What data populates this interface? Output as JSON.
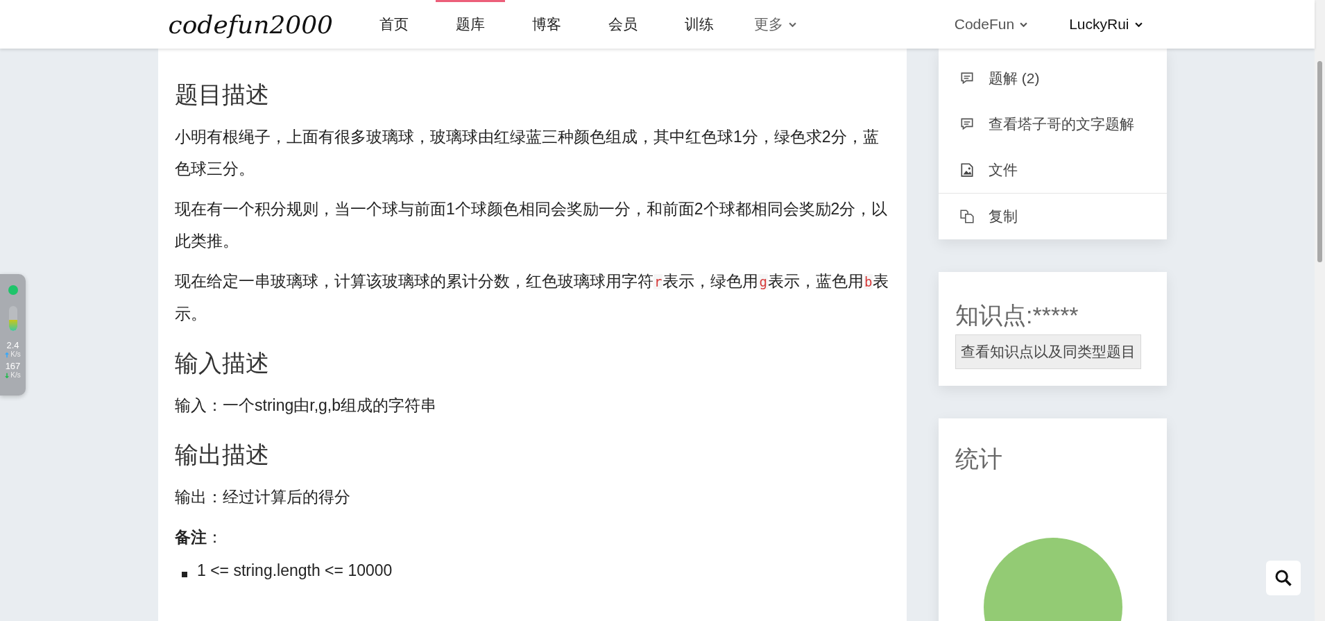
{
  "header": {
    "logo": "codefun2000",
    "nav": [
      {
        "label": "首页",
        "selected": false,
        "has_menu": false
      },
      {
        "label": "题库",
        "selected": true,
        "has_menu": false
      },
      {
        "label": "博客",
        "selected": false,
        "has_menu": false
      },
      {
        "label": "会员",
        "selected": false,
        "has_menu": false
      },
      {
        "label": "训练",
        "selected": false,
        "has_menu": false
      },
      {
        "label": "更多",
        "selected": false,
        "has_menu": true
      }
    ],
    "right_menus": [
      "CodeFun",
      "LuckyRui"
    ]
  },
  "problem": {
    "sections": [
      {
        "heading": "题目描述",
        "paragraphs": [
          [
            {
              "kind": "text",
              "text": "小明有根绳子，上面有很多玻璃球，玻璃球由红绿蓝三种颜色组成，其中红色球1分，绿色求2分，蓝色球三分。"
            }
          ],
          [
            {
              "kind": "text",
              "text": "现在有一个积分规则，当一个球与前面1个球颜色相同会奖励一分，和前面2个球都相同会奖励2分，以此类推。"
            }
          ],
          [
            {
              "kind": "text",
              "text": "现在给定一串玻璃球，计算该玻璃球的累计分数，红色玻璃球用字符"
            },
            {
              "kind": "code",
              "text": "r"
            },
            {
              "kind": "text",
              "text": "表示，绿色用"
            },
            {
              "kind": "code",
              "text": "g"
            },
            {
              "kind": "text",
              "text": "表示，蓝色用"
            },
            {
              "kind": "code",
              "text": "b"
            },
            {
              "kind": "text",
              "text": "表示。"
            }
          ]
        ]
      },
      {
        "heading": "输入描述",
        "paragraphs": [
          [
            {
              "kind": "text",
              "text": "输入：一个string由r,g,b组成的字符串"
            }
          ]
        ]
      },
      {
        "heading": "输出描述",
        "paragraphs": [
          [
            {
              "kind": "text",
              "text": "输出：经过计算后的得分"
            }
          ]
        ]
      }
    ],
    "note": "**备注**：",
    "note_items": [
      "1 <= string.length <= 10000"
    ]
  },
  "sidebar": {
    "menu_groups": [
      [
        {
          "kind": "comment",
          "label": "题解 (2)"
        },
        {
          "kind": "comment",
          "label": "查看塔子哥的文字题解"
        },
        {
          "kind": "file",
          "label": "文件"
        }
      ],
      [
        {
          "kind": "copy",
          "label": "复制"
        }
      ]
    ],
    "knowledge": {
      "title": "知识点:*****",
      "button": "查看知识点以及同类型题目"
    },
    "stats": {
      "title": "统计"
    }
  },
  "net_widget": {
    "level": 0.45,
    "upload": "2.4",
    "upload_unit": "K/s",
    "download": "167",
    "download_unit": "K/s"
  }
}
